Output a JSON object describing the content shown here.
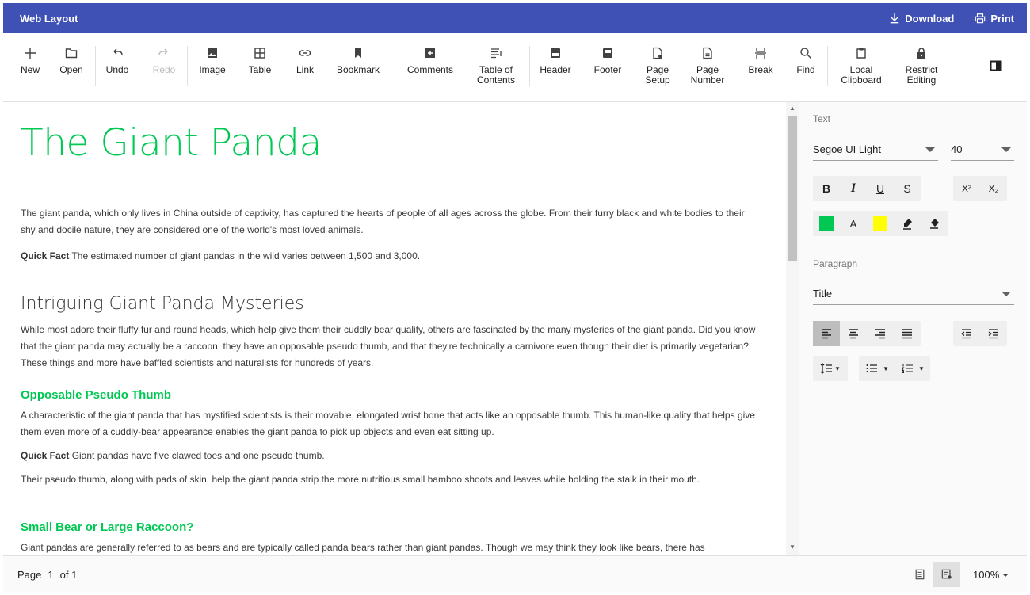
{
  "titlebar": {
    "title": "Web Layout",
    "download": "Download",
    "print": "Print"
  },
  "toolbar": {
    "new": "New",
    "open": "Open",
    "undo": "Undo",
    "redo": "Redo",
    "image": "Image",
    "table": "Table",
    "link": "Link",
    "bookmark": "Bookmark",
    "comments": "Comments",
    "toc": "Table of\nContents",
    "header": "Header",
    "footer": "Footer",
    "page_setup": "Page\nSetup",
    "page_number": "Page\nNumber",
    "break": "Break",
    "find": "Find",
    "local_clipboard": "Local\nClipboard",
    "restrict_editing": "Restrict\nEditing"
  },
  "document": {
    "title": "The Giant Panda",
    "p1": "The giant panda, which only lives in China outside of captivity, has captured the hearts of people of all ages across the globe. From their furry black and white bodies to their shy and docile nature, they are considered one of the world's most loved animals.",
    "qf_label": "Quick Fact",
    "qf1": " The estimated number of giant pandas in the wild varies between 1,500 and 3,000.",
    "h2": "Intriguing Giant Panda Mysteries",
    "p2": "While most adore their fluffy fur and round heads, which help give them their cuddly bear quality, others are fascinated by the many mysteries of the giant panda. Did you know that the giant panda may actually be a raccoon, they have an opposable pseudo thumb, and that they're technically a carnivore even though their diet is primarily vegetarian? These things and more have baffled scientists and naturalists for hundreds of years.",
    "h3a": "Opposable Pseudo Thumb",
    "p3": "A characteristic of the giant panda that has mystified scientists is their movable, elongated wrist bone that acts like an opposable thumb. This human-like quality that helps give them even more of a cuddly-bear appearance enables the giant panda to pick up objects and even eat sitting up.",
    "qf2": " Giant pandas have five clawed toes and one pseudo thumb.",
    "p4": "Their pseudo thumb, along with pads of skin, help the giant panda strip the more nutritious small bamboo shoots and leaves while holding the stalk in their mouth.",
    "h3b": "Small Bear or Large Raccoon?",
    "p5": "Giant pandas are generally referred to as bears and are typically called panda bears rather than giant pandas. Though we may think they look like bears, there has"
  },
  "pane": {
    "text_title": "Text",
    "font_family": "Segoe UI Light",
    "font_size": "40",
    "bold": "B",
    "italic": "I",
    "underline": "U",
    "strike": "S",
    "superscript": "X²",
    "subscript": "X₂",
    "font_color_label": "A",
    "font_color": "#00c853",
    "highlight_color": "#ffff00",
    "paragraph_title": "Paragraph",
    "style": "Title"
  },
  "status": {
    "page_label": "Page",
    "page_num": "1",
    "of_label": "of 1",
    "zoom": "100%"
  },
  "colors": {
    "accent": "#3f51b5",
    "heading": "#00c853"
  }
}
